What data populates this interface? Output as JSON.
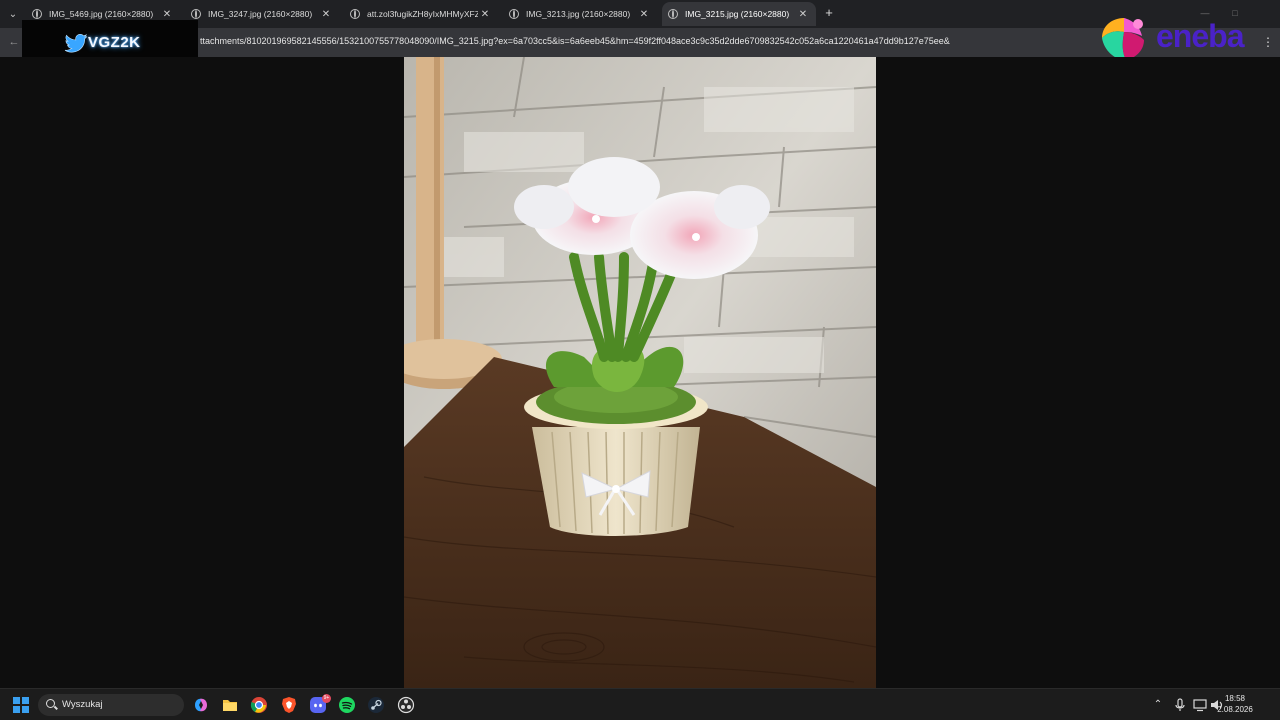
{
  "tabs": [
    {
      "label": "IMG_5469.jpg (2160×2880)",
      "active": false
    },
    {
      "label": "IMG_3247.jpg (2160×2880)",
      "active": false
    },
    {
      "label": "att.zol3fugikZH8yIxMHMyXFZ…",
      "active": false
    },
    {
      "label": "IMG_3213.jpg (2160×2880)",
      "active": false
    },
    {
      "label": "IMG_3215.jpg (2160×2880)",
      "active": true
    }
  ],
  "address_bar": {
    "url": "ttachments/810201969582145556/1532100755778048090/IMG_3215.jpg?ex=6a703cc5&is=6a6eeb45&hm=459f2ff048ace3c9c35d2dde6709832542c052a6ca1220461a47dd9b127e75ee&"
  },
  "overlays": {
    "streamer_logo": "VGZ2K",
    "sponsor_logo": "eneba"
  },
  "taskbar": {
    "search_placeholder": "Wyszukaj",
    "discord_badge": "9+",
    "time": "18:58",
    "date": "2.08.2026"
  },
  "colors": {
    "tab_strip": "#202124",
    "toolbar": "#35363a",
    "viewer_bg": "#0e0e0e",
    "taskbar": "#1c1c1c",
    "eneba_brand": "#4a22c8",
    "vgz_glow": "#3aa0ff"
  },
  "icons": [
    "tab-search-icon",
    "globe-icon",
    "close-icon",
    "plus-icon",
    "back-arrow-icon",
    "menu-dots-icon",
    "windows-start-icon",
    "search-icon",
    "copilot-icon",
    "file-explorer-icon",
    "chrome-icon",
    "brave-icon",
    "discord-icon",
    "spotify-icon",
    "steam-icon",
    "obs-icon",
    "chevron-up-icon",
    "microphone-icon",
    "network-icon",
    "volume-icon"
  ]
}
